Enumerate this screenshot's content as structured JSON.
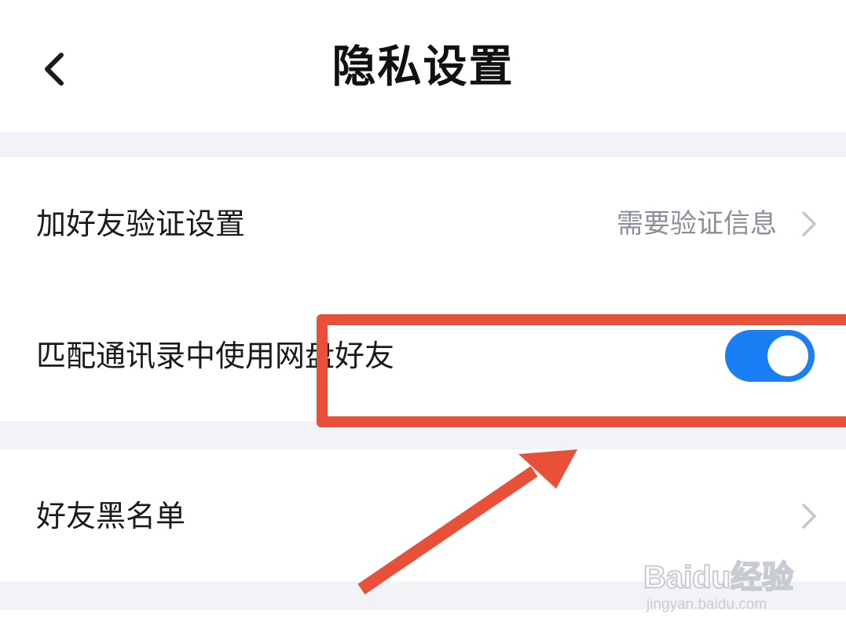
{
  "header": {
    "title": "隐私设置",
    "back_icon": "chevron-left-icon"
  },
  "settings": {
    "friend_verification": {
      "label": "加好友验证设置",
      "value": "需要验证信息"
    },
    "match_contacts": {
      "label": "匹配通讯录中使用网盘好友",
      "enabled": true
    },
    "blacklist": {
      "label": "好友黑名单"
    }
  },
  "annotation": {
    "color": "#e8503a"
  },
  "watermark": {
    "logo": "Baidu经验",
    "url": "jingyan.baidu.com"
  },
  "colors": {
    "toggle_on": "#1a7ef5",
    "section_gap": "#f2f3f6"
  }
}
